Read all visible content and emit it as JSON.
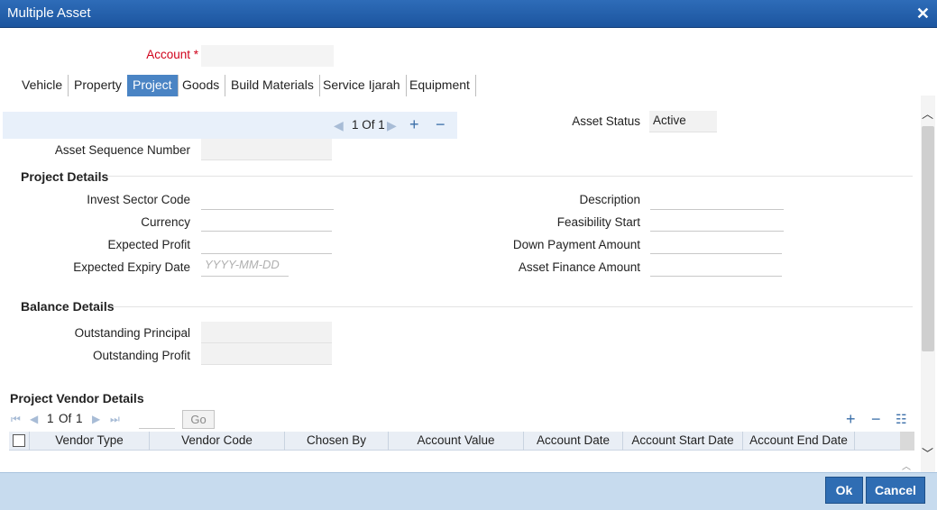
{
  "window": {
    "title": "Multiple Asset"
  },
  "account": {
    "label": "Account",
    "required_mark": "*",
    "value": ""
  },
  "tabs": [
    {
      "label": "Vehicle"
    },
    {
      "label": "Property"
    },
    {
      "label": "Project",
      "active": true
    },
    {
      "label": "Goods"
    },
    {
      "label": "Build Materials"
    },
    {
      "label": "Service Ijarah"
    },
    {
      "label": "Equipment"
    }
  ],
  "record_nav": {
    "text": "1 Of 1"
  },
  "asset_status": {
    "label": "Asset Status",
    "value": "Active"
  },
  "asset_sequence": {
    "label": "Asset Sequence Number",
    "value": ""
  },
  "project_details": {
    "title": "Project Details",
    "invest_sector_code": {
      "label": "Invest Sector Code",
      "value": ""
    },
    "currency": {
      "label": "Currency",
      "value": ""
    },
    "expected_profit": {
      "label": "Expected Profit",
      "value": ""
    },
    "expected_expiry_date": {
      "label": "Expected Expiry Date",
      "placeholder": "YYYY-MM-DD"
    },
    "description": {
      "label": "Description",
      "value": ""
    },
    "feasibility_start": {
      "label": "Feasibility Start",
      "value": ""
    },
    "down_payment_amount": {
      "label": "Down Payment Amount",
      "value": ""
    },
    "asset_finance_amount": {
      "label": "Asset Finance Amount",
      "value": ""
    }
  },
  "balance_details": {
    "title": "Balance Details",
    "outstanding_principal": {
      "label": "Outstanding Principal",
      "value": ""
    },
    "outstanding_profit": {
      "label": "Outstanding Profit",
      "value": ""
    }
  },
  "vendor_details": {
    "title": "Project Vendor Details",
    "pager_current": "1",
    "pager_of": "Of",
    "pager_total": "1",
    "go_label": "Go",
    "columns": [
      "Vendor Type",
      "Vendor Code",
      "Chosen By",
      "Account Value",
      "Account Date",
      "Account Start Date",
      "Account End Date"
    ]
  },
  "footer": {
    "ok_label": "Ok",
    "cancel_label": "Cancel"
  }
}
